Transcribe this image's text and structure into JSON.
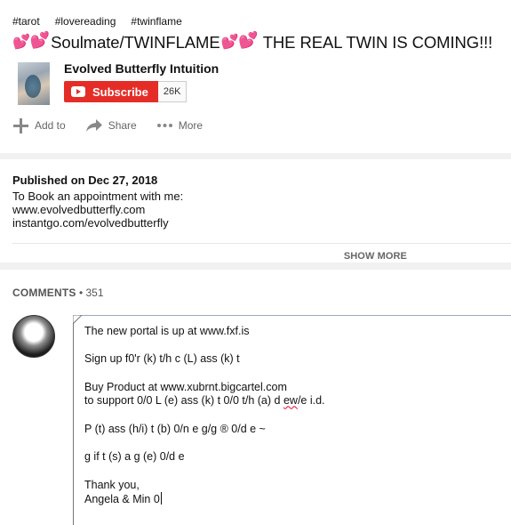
{
  "video": {
    "tags": [
      "#tarot",
      "#lovereading",
      "#twinflame"
    ],
    "title": "Soulmate/TWINFLAME",
    "title_suffix": "THE REAL TWIN IS COMING!!!",
    "channel_name": "Evolved Butterfly Intuition",
    "subscribe_label": "Subscribe",
    "subscriber_count": "26K",
    "actions": {
      "add_to": "Add to",
      "share": "Share",
      "more": "More"
    }
  },
  "description": {
    "published": "Published on Dec 27, 2018",
    "lines": [
      "To Book an appointment with me:",
      "www.evolvedbutterfly.com",
      "instantgo.com/evolvedbutterfly"
    ],
    "show_more": "SHOW MORE"
  },
  "comments": {
    "label": "COMMENTS",
    "separator": "•",
    "count": "351",
    "draft": {
      "l1": "The new portal is up at www.fxf.is",
      "l2": "Sign up f0'r (k) t/h c (L) ass (k) t",
      "l3": "Buy Product at www.xubrnt.bigcartel.com",
      "l4a": "to support 0/0 L (e) ass (k) t 0/0 t/h (a) d",
      "l4b": "ew",
      "l4c": "/e i.d.",
      "l5": "P (t) ass (h/i) t (b) 0/n e g/g ® 0/d e ~",
      "l6": "g if t (s) a g (e) 0/d e",
      "l7": "Thank you,",
      "l8": "Angela & Min 0"
    }
  },
  "colors": {
    "subscribe_red": "#e52d27",
    "heart_pink": "#ff5fc4"
  },
  "icons": {
    "add": "plus-icon",
    "share": "share-arrow-icon",
    "more": "more-dots-icon",
    "play": "youtube-play-icon"
  }
}
